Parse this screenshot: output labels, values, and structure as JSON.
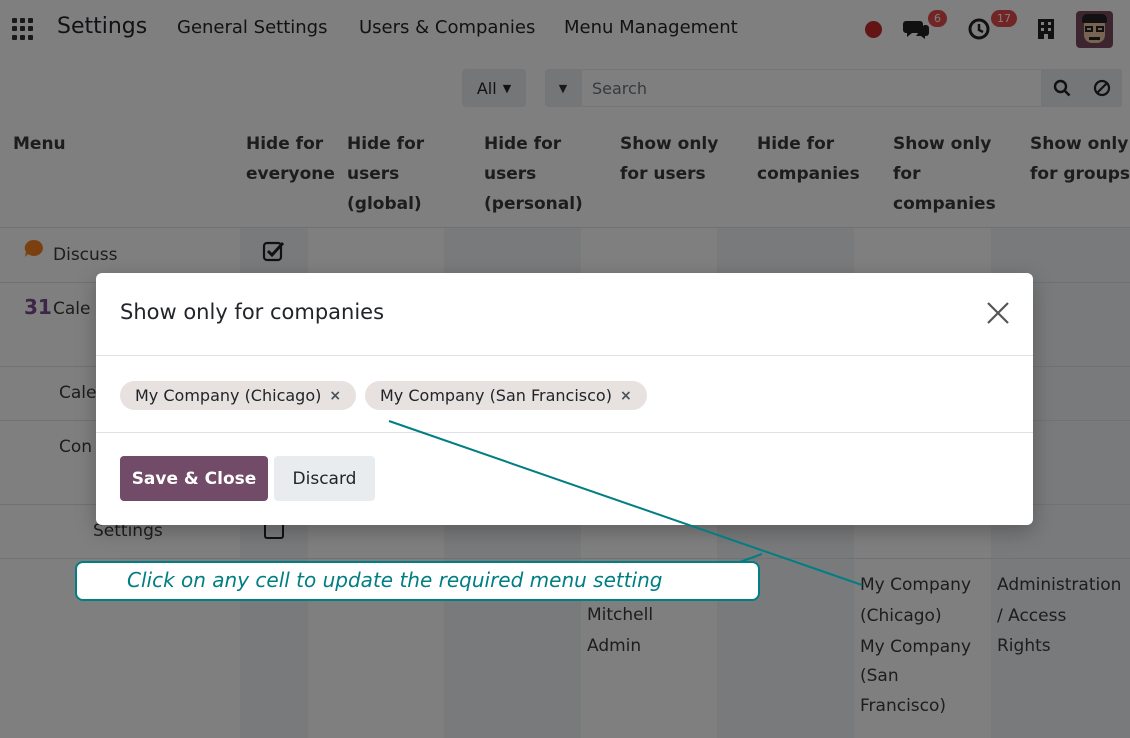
{
  "navbar": {
    "brand": "Settings",
    "menus": [
      "General Settings",
      "Users & Companies",
      "Menu Management"
    ],
    "messages_badge": "6",
    "activities_badge": "17"
  },
  "control_panel": {
    "filter_label": "All",
    "search_placeholder": "Search"
  },
  "table": {
    "columns": [
      "Menu",
      "Hide for everyone",
      "Hide for users (global)",
      "Hide for users (personal)",
      "Show only for users",
      "Hide for companies",
      "Show only for companies",
      "Show only for groups"
    ],
    "rows": [
      {
        "menu": "Discuss",
        "hide_everyone": true
      },
      {
        "menu": "Calendar"
      },
      {
        "menu": "Calendar"
      },
      {
        "menu": "Configuration"
      },
      {
        "menu": "Settings",
        "hide_everyone": false
      },
      {
        "menu": "",
        "show_users": "Mitchell Admin",
        "show_companies": "My Company (Chicago) My Company (San Francisco)",
        "show_groups": "Administration / Access Rights"
      }
    ],
    "visible": {
      "discuss": "Discuss",
      "cale1": "Cale",
      "cale2": "Cale",
      "con": "Con",
      "settings": "Settings",
      "mitchell": "Mitchell",
      "admin": "Admin",
      "comp1a": "My Company",
      "comp1b": "(Chicago)",
      "comp2a": "My Company",
      "comp2b": "(San",
      "comp2c": "Francisco)",
      "groups_a": "Administration",
      "groups_b": "/ Access",
      "groups_c": "Rights"
    }
  },
  "modal": {
    "title": "Show only for companies",
    "tags": [
      "My Company (Chicago)",
      "My Company (San Francisco)"
    ],
    "save_label": "Save & Close",
    "discard_label": "Discard"
  },
  "callout": {
    "text": "Click on any cell to update the required menu setting",
    "color": "#017e84"
  },
  "colors": {
    "primary": "#714b67",
    "badge": "#e34a4a"
  }
}
